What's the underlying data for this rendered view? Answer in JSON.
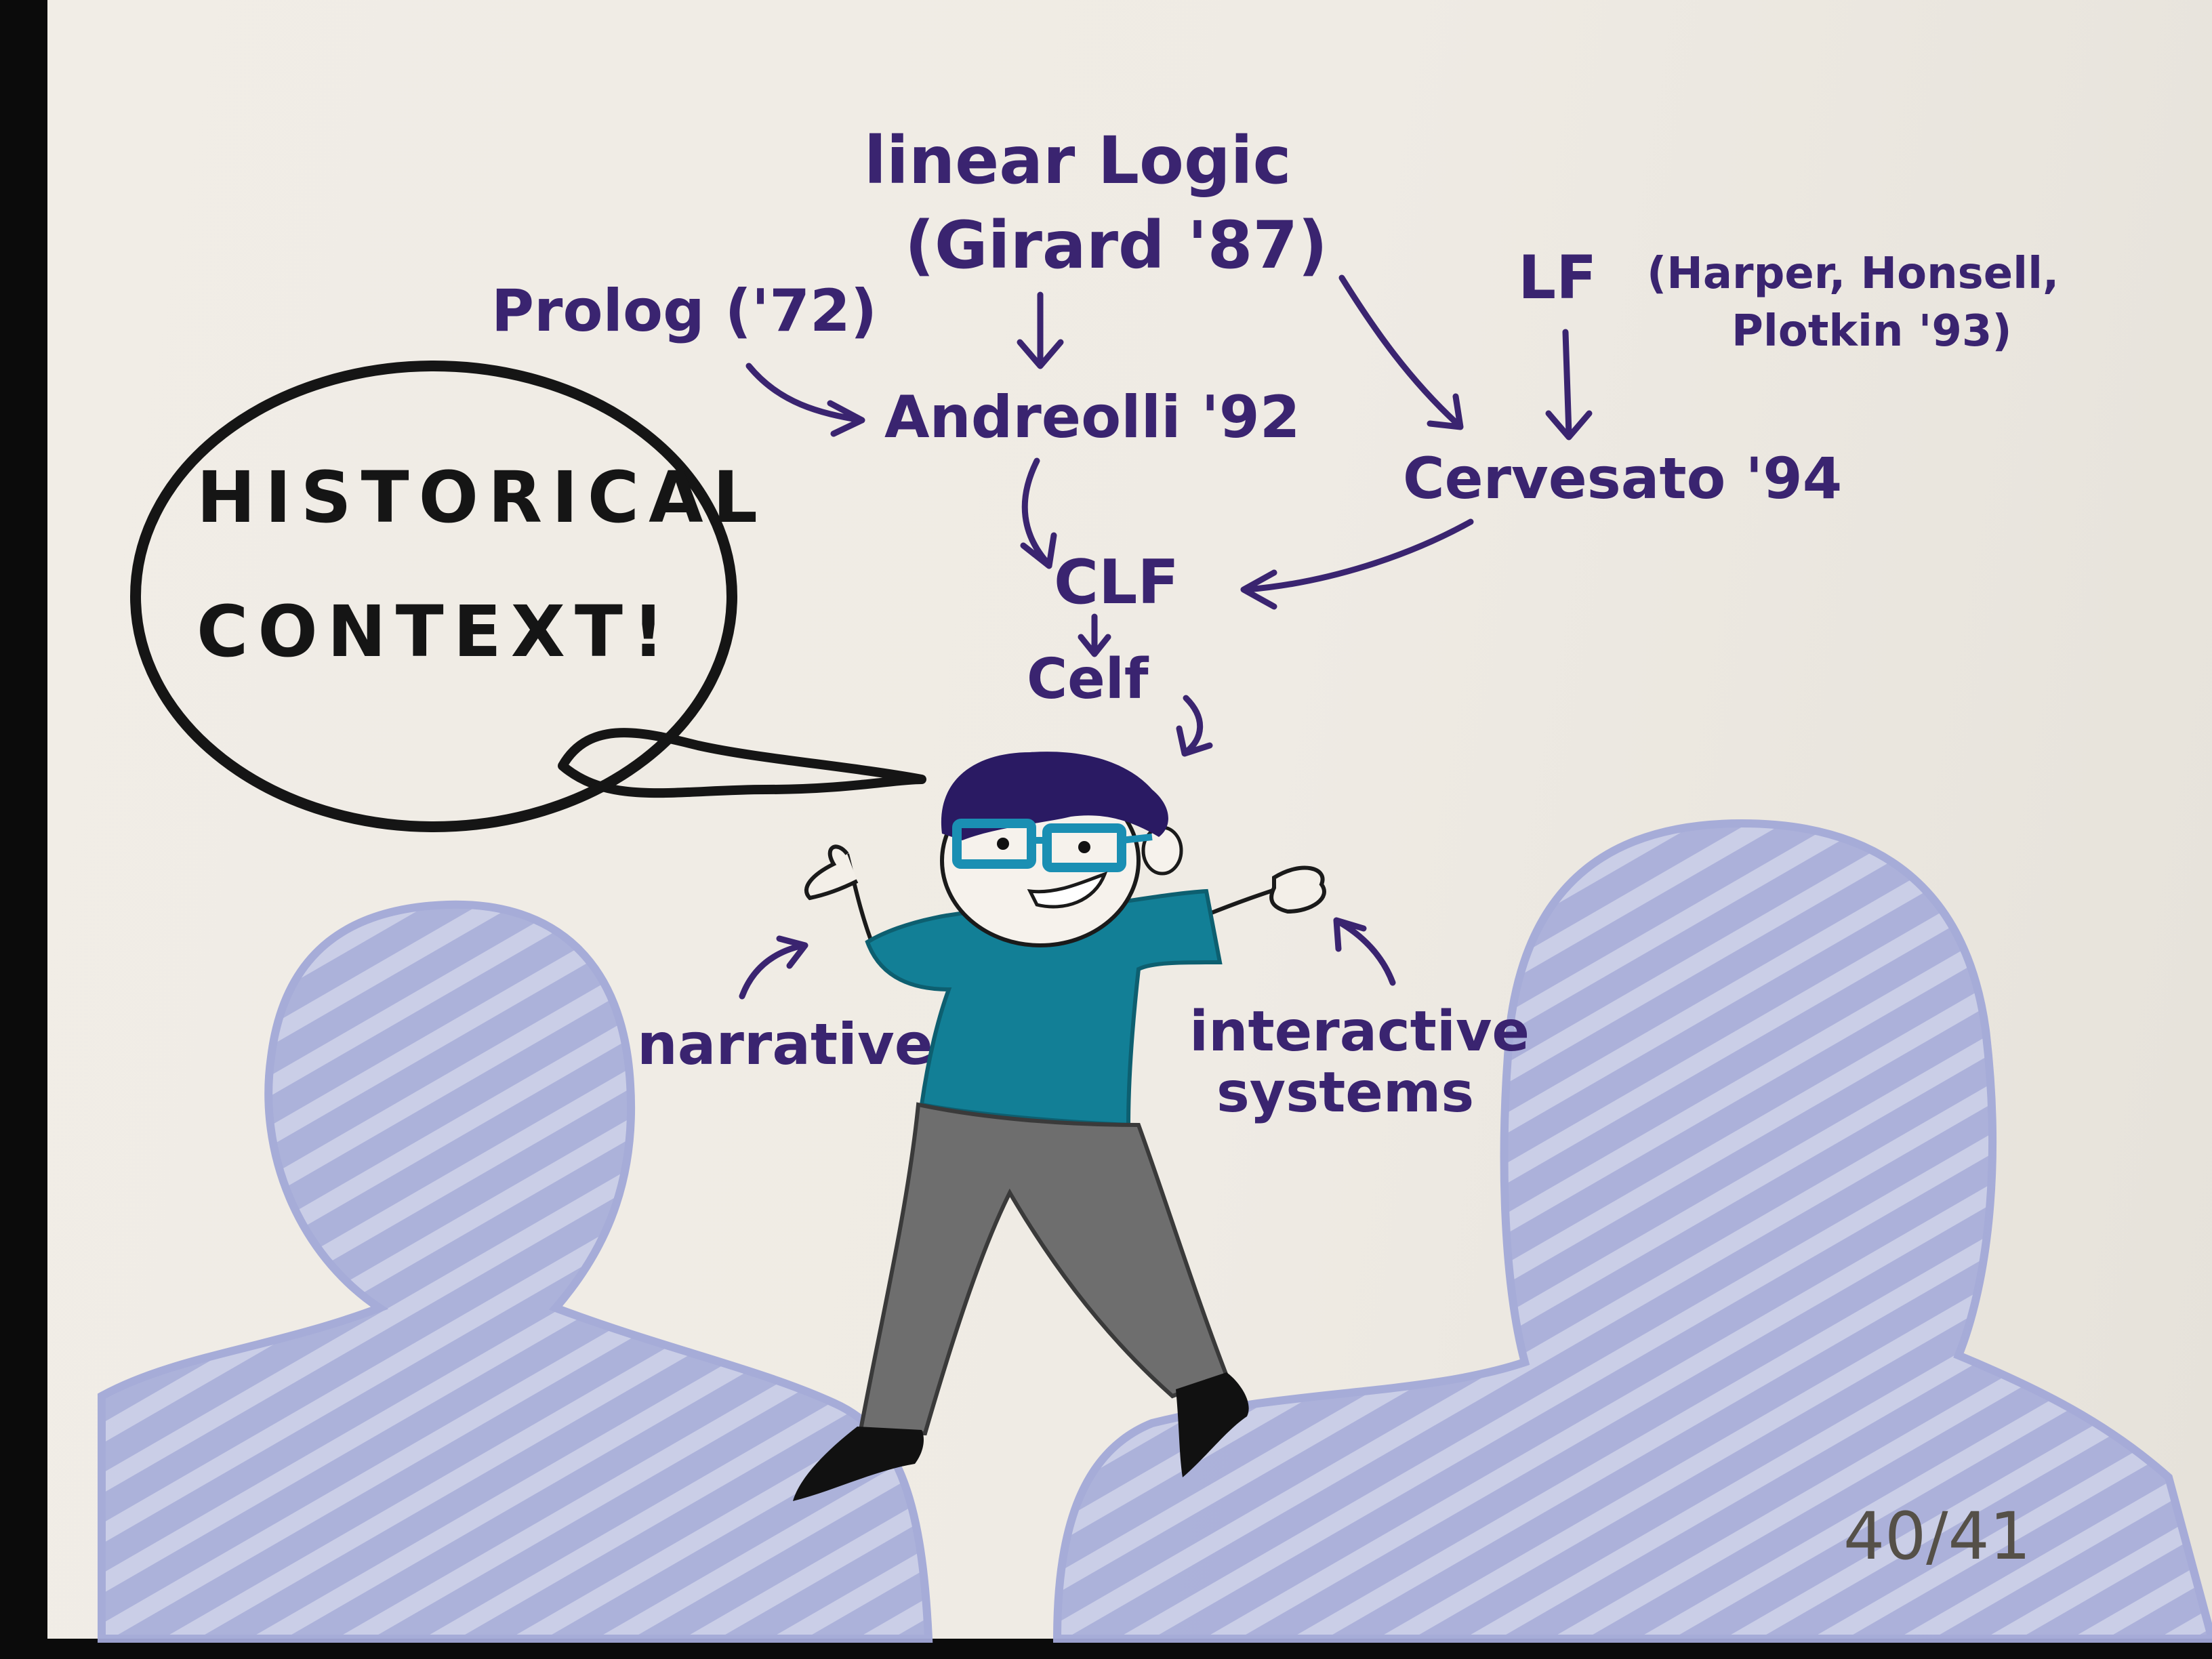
{
  "diagram": {
    "nodes": {
      "linear_logic": "linear Logic",
      "girard": "(Girard '87)",
      "prolog": "Prolog ('72)",
      "lf": "LF",
      "lf_authors_1": "(Harper, Honsell,",
      "lf_authors_2": "Plotkin '93)",
      "andreolli": "Andreolli '92",
      "cervesato": "Cervesato '94",
      "clf": "CLF",
      "celf": "Celf"
    },
    "speech_bubble": {
      "line1": "HISTORICAL",
      "line2": "CONTEXT!"
    },
    "labels": {
      "narrative": "narrative",
      "interactive_1": "interactive",
      "interactive_2": "systems"
    },
    "page_number": "40/41",
    "colors": {
      "ink": "#3a2470",
      "bubble_ink": "#151515",
      "audience": "#aab0db",
      "shirt": "#127f96",
      "pants": "#6e6e6e",
      "hair": "#2a1a63",
      "glasses": "#1a8fb3"
    }
  }
}
